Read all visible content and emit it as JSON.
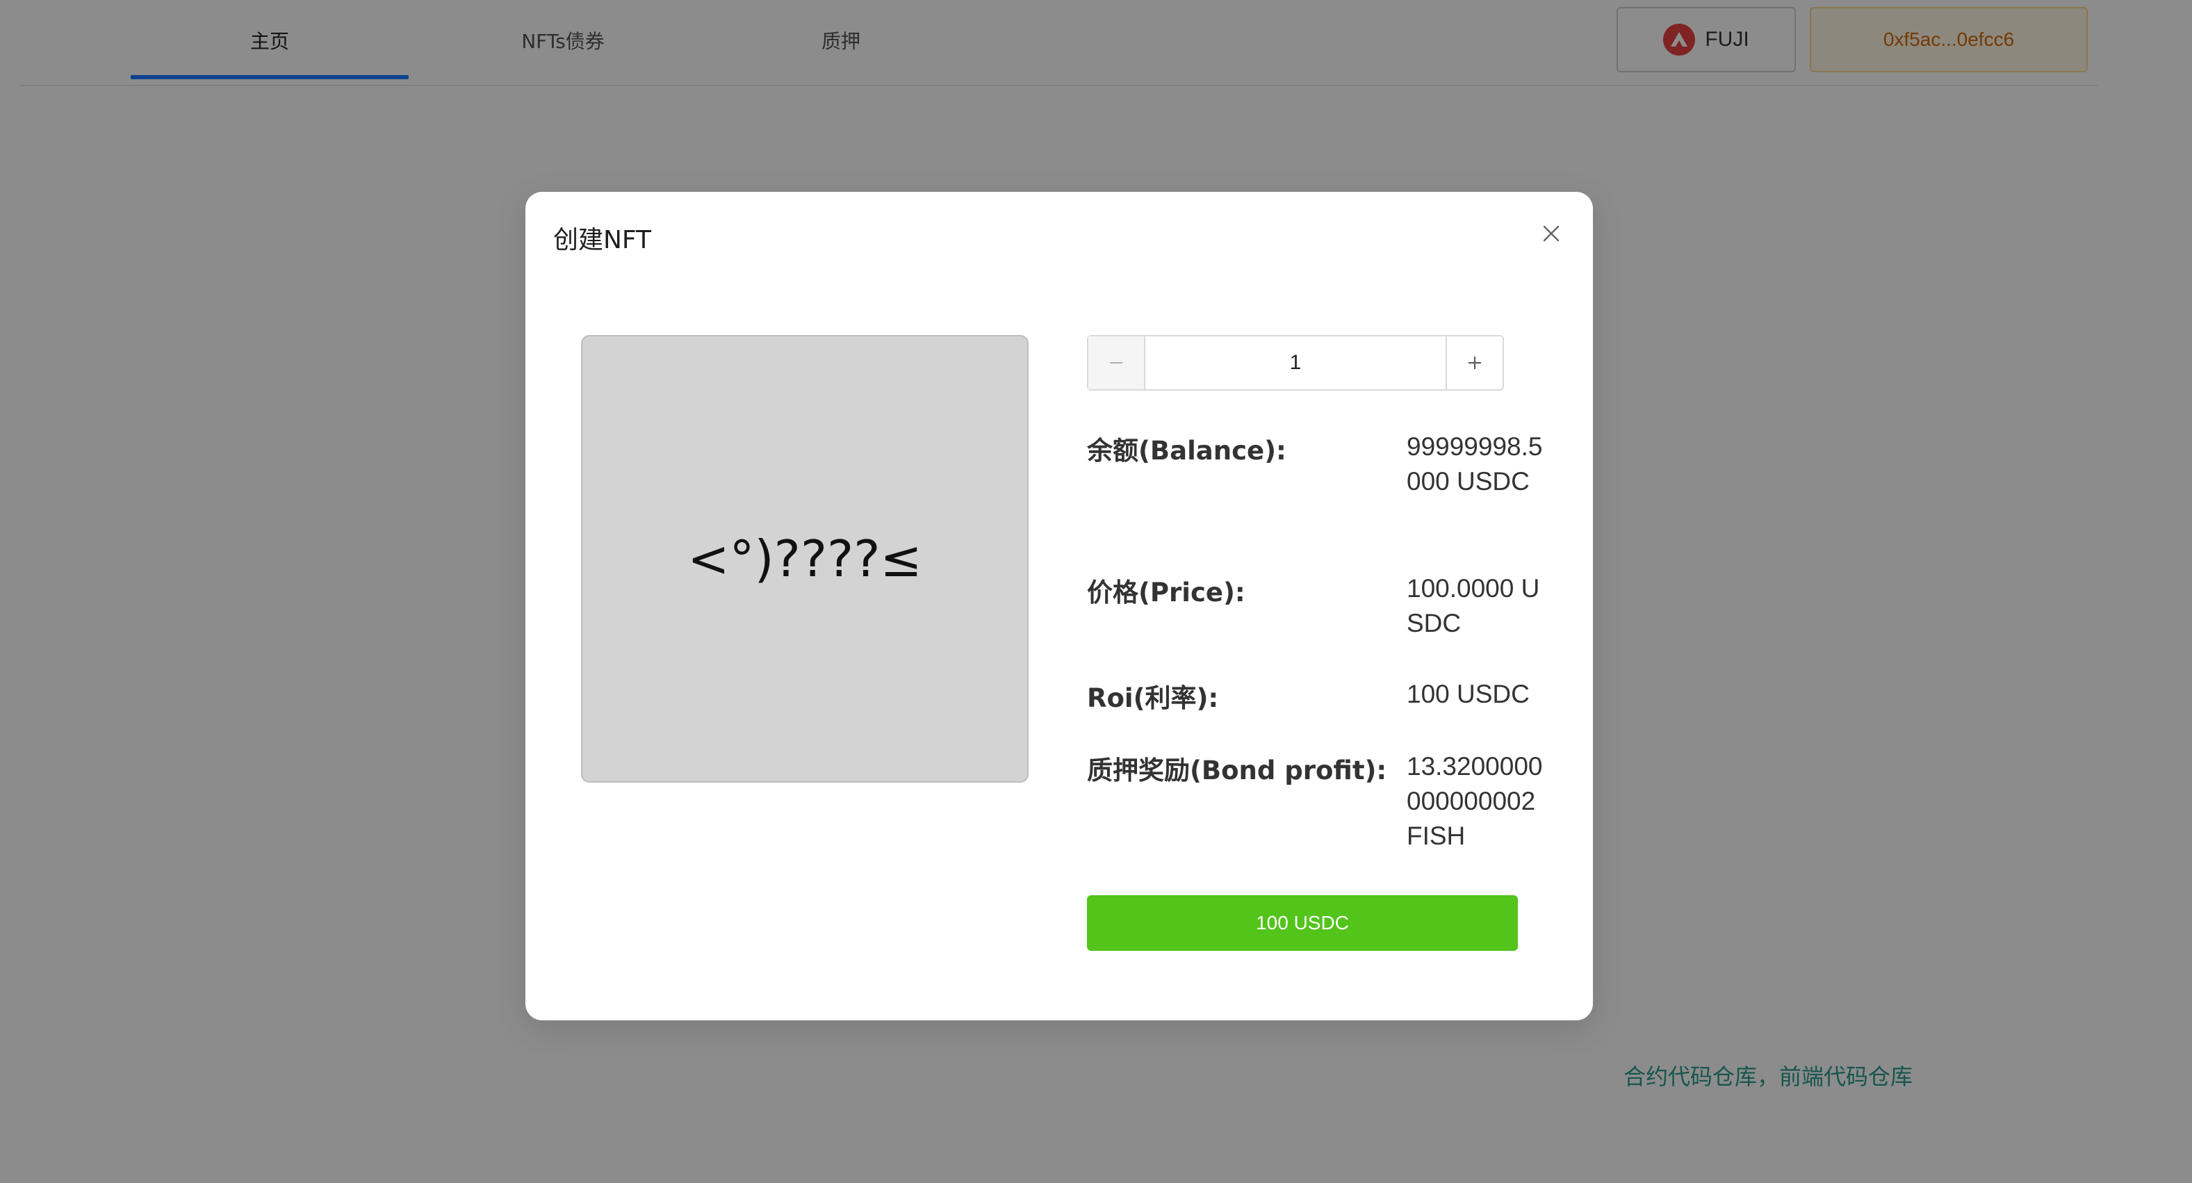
{
  "nav": {
    "tabs": [
      {
        "label": "主页",
        "active": true
      },
      {
        "label": "NFTs债券",
        "active": false
      },
      {
        "label": "质押",
        "active": false
      }
    ],
    "network_label": "FUJI",
    "network_icon": "avalanche-logo-icon",
    "wallet_address": "0xf5ac...0efcc6"
  },
  "footer": {
    "links_text": "合约代码仓库，前端代码仓库"
  },
  "modal": {
    "title": "创建NFT",
    "close_icon": "close-icon",
    "nft_preview_text": "<°)????≤",
    "quantity": "1",
    "info": [
      {
        "label": "余额(Balance):",
        "value": "99999998.5000 USDC"
      },
      {
        "label": "价格(Price):",
        "value": "100.0000 USDC"
      },
      {
        "label": "Roi(利率):",
        "value": "100 USDC"
      },
      {
        "label": "质押奖励(Bond profit):",
        "value": "13.3200000000000002 FISH"
      }
    ],
    "buy_button_label": "100 USDC"
  },
  "colors": {
    "accent": "#1677ff",
    "buy_button": "#52c41a",
    "wallet_text": "#d46b08",
    "link": "#2a9d8f"
  }
}
